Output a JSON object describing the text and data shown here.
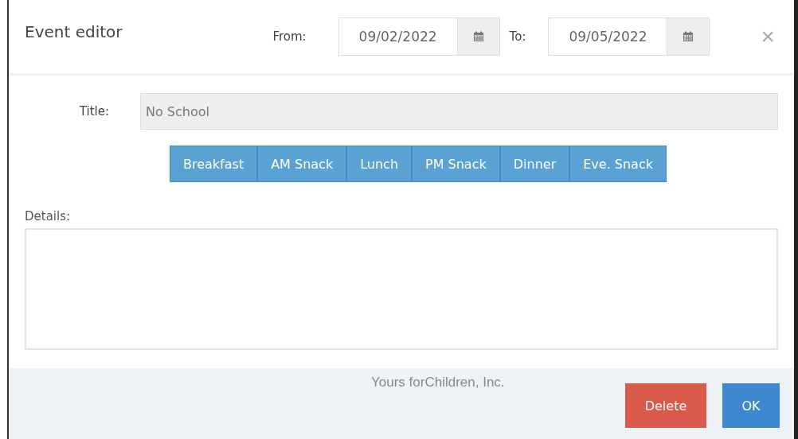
{
  "dialog": {
    "title": "Event editor",
    "from": {
      "label": "From:",
      "value": "09/02/2022"
    },
    "to": {
      "label": "To:",
      "value": "09/05/2022"
    },
    "close": "×"
  },
  "form": {
    "title_label": "Title:",
    "title_value": "No School",
    "meals": [
      "Breakfast",
      "AM Snack",
      "Lunch",
      "PM Snack",
      "Dinner",
      "Eve. Snack"
    ],
    "details_label": "Details:"
  },
  "footer": {
    "note": "Yours forChildren, Inc.",
    "buttons": [
      {
        "label": "Delete",
        "kind": "danger"
      },
      {
        "label": "OK",
        "kind": "primary"
      }
    ]
  }
}
